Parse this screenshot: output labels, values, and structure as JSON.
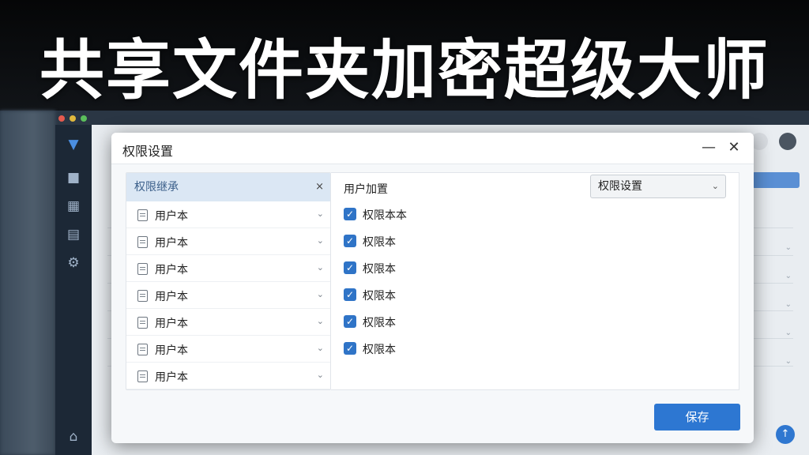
{
  "headline": "共享文件夹加密超级大师",
  "dialog": {
    "title": "权限设置",
    "minimize_icon": "minimize-icon",
    "close_icon": "close-icon",
    "tree": {
      "header": "权限继承",
      "header_close": "×",
      "items": [
        {
          "label": "用户本"
        },
        {
          "label": "用户本"
        },
        {
          "label": "用户本"
        },
        {
          "label": "用户本"
        },
        {
          "label": "用户本"
        },
        {
          "label": "用户本"
        },
        {
          "label": "用户本"
        }
      ]
    },
    "right": {
      "header": "用户加置",
      "select_value": "权限设置",
      "permissions": [
        {
          "label": "权限本本",
          "checked": true
        },
        {
          "label": "权限本",
          "checked": true
        },
        {
          "label": "权限本",
          "checked": true
        },
        {
          "label": "权限本",
          "checked": true
        },
        {
          "label": "权限本",
          "checked": true
        },
        {
          "label": "权限本",
          "checked": true
        }
      ]
    },
    "save_label": "保存"
  },
  "colors": {
    "accent": "#2d77d2",
    "tree_header_bg": "#dbe7f4"
  }
}
